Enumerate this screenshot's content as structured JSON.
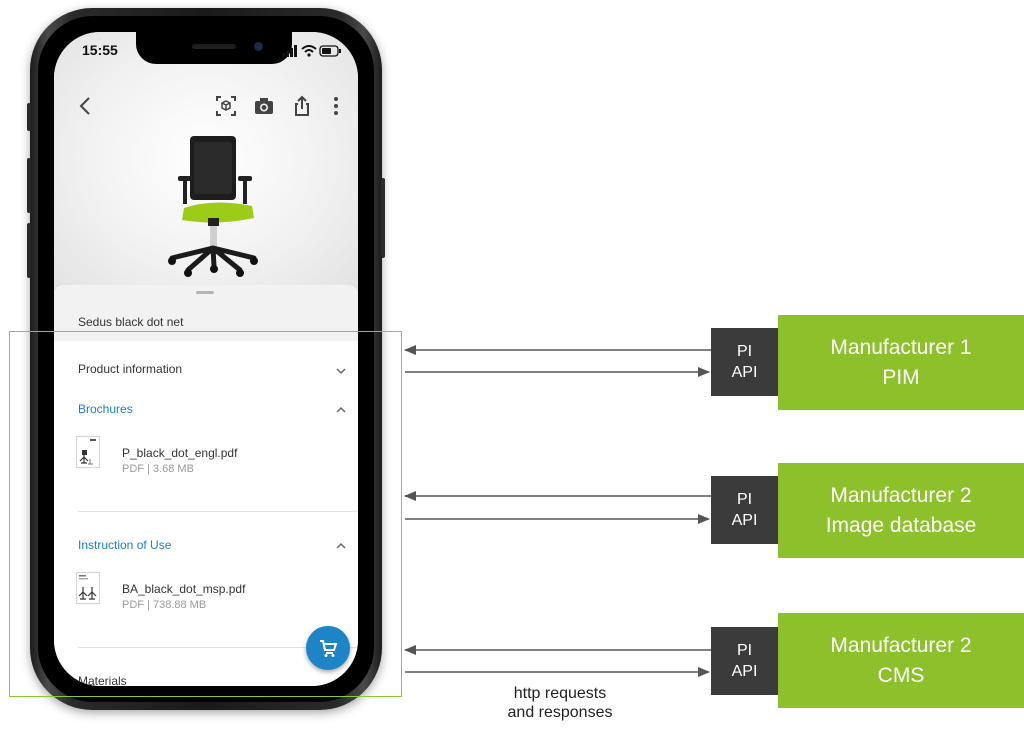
{
  "phone": {
    "status_time": "15:55",
    "toolbar_icons": [
      "back-icon",
      "ar-view-icon",
      "camera-icon",
      "share-icon",
      "more-icon"
    ],
    "product_title": "Sedus black dot net",
    "sections": {
      "product_information": "Product information",
      "brochures": "Brochures",
      "instruction_of_use": "Instruction of Use",
      "materials": "Materials"
    },
    "files": [
      {
        "name": "P_black_dot_engl.pdf",
        "meta": "PDF | 3.68 MB"
      },
      {
        "name": "BA_black_dot_msp.pdf",
        "meta": "PDF | 738.88 MB"
      }
    ],
    "fab_icon": "cart-icon"
  },
  "diagram": {
    "colors": {
      "accent": "#8cc12b",
      "api_box": "#3b3b3b",
      "arrow": "#555555",
      "link": "#1e7ec8"
    },
    "sources": [
      {
        "api_line1": "PI",
        "api_line2": "API",
        "name_line1": "Manufacturer 1",
        "name_line2": "PIM"
      },
      {
        "api_line1": "PI",
        "api_line2": "API",
        "name_line1": "Manufacturer 2",
        "name_line2": "Image database"
      },
      {
        "api_line1": "PI",
        "api_line2": "API",
        "name_line1": "Manufacturer 2",
        "name_line2": "CMS"
      }
    ],
    "caption_line1": "http requests",
    "caption_line2": "and responses"
  }
}
